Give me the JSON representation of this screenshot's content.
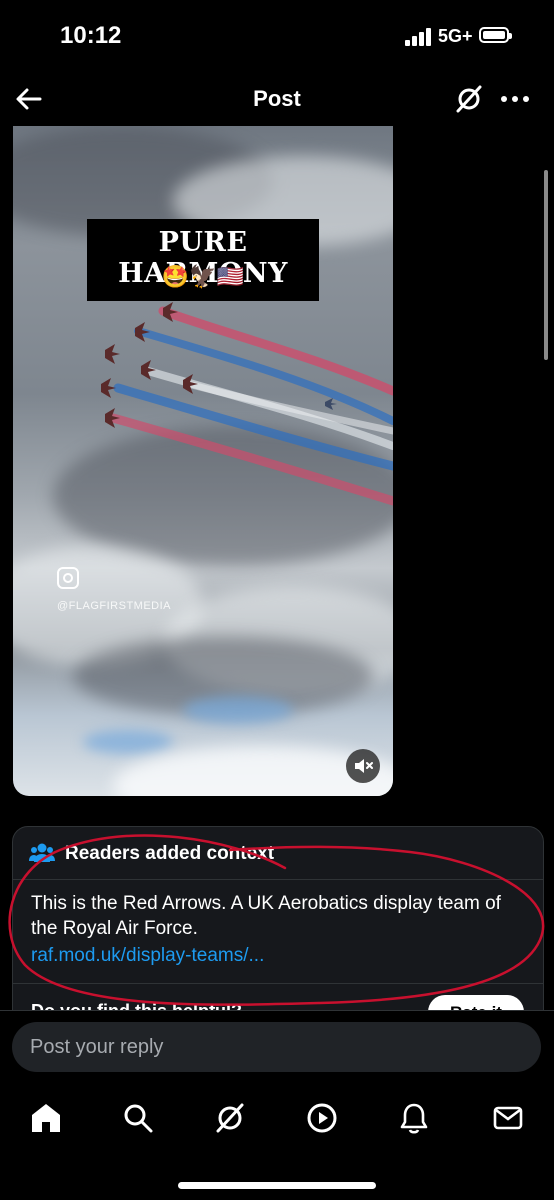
{
  "status_bar": {
    "time": "10:12",
    "network": "5G+"
  },
  "header": {
    "title": "Post"
  },
  "media": {
    "caption_title": "PURE HARMONY",
    "caption_emoji": "🤩🦅🇺🇸",
    "watermark": "@FLAGFIRSTMEDIA"
  },
  "context_note": {
    "heading": "Readers added context",
    "body": "This is the Red Arrows. A UK Aerobatics display team of the Royal Air Force.",
    "link": "raf.mod.uk/display-teams/...",
    "helpful_question": "Do you find this helpful?",
    "rate_button": "Rate it"
  },
  "reply": {
    "placeholder": "Post your reply"
  },
  "icons": {
    "back": "arrow-left-icon",
    "grok": "grok-icon",
    "more": "more-horizontal-icon",
    "mute": "volume-muted-icon",
    "people": "people-icon",
    "tabs": [
      "home-icon",
      "search-icon",
      "grok-icon",
      "video-icon",
      "notifications-bell-icon",
      "messages-envelope-icon"
    ]
  },
  "colors": {
    "accent": "#1d9bf0",
    "annotation": "#c8102e",
    "trail_red": "#d24a6a",
    "trail_blue": "#2e6fc0"
  }
}
